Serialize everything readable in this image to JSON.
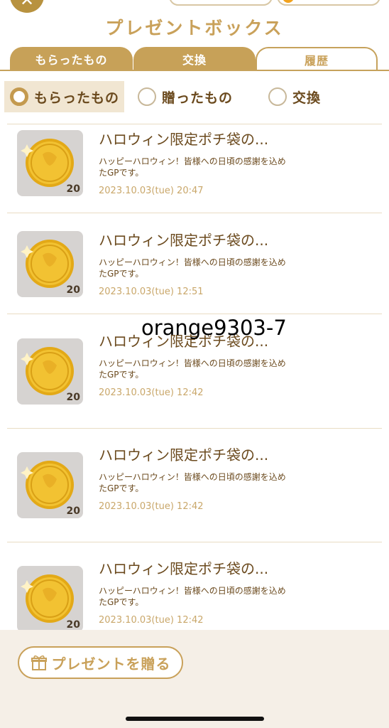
{
  "header": {
    "close_label": "✕",
    "title": "プレゼントボックス"
  },
  "tabs": [
    {
      "label": "もらったもの"
    },
    {
      "label": "交換"
    },
    {
      "label": "履歴"
    }
  ],
  "filters": [
    {
      "label": "もらったもの",
      "selected": true
    },
    {
      "label": "贈ったもの",
      "selected": false
    },
    {
      "label": "交換",
      "selected": false
    }
  ],
  "items": [
    {
      "name": "ハロウィン限定ポチ袋の...",
      "desc": "ハッピーハロウィン！皆様への日頃の感謝を込めたGPです。",
      "date": "2023.10.03(tue) 20:47",
      "qty": "20"
    },
    {
      "name": "ハロウィン限定ポチ袋の...",
      "desc": "ハッピーハロウィン！皆様への日頃の感謝を込めたGPです。",
      "date": "2023.10.03(tue) 12:51",
      "qty": "20"
    },
    {
      "name": "ハロウィン限定ポチ袋の...",
      "desc": "ハッピーハロウィン！皆様への日頃の感謝を込めたGPです。",
      "date": "2023.10.03(tue) 12:42",
      "qty": "20"
    },
    {
      "name": "ハロウィン限定ポチ袋の...",
      "desc": "ハッピーハロウィン！皆様への日頃の感謝を込めたGPです。",
      "date": "2023.10.03(tue) 12:42",
      "qty": "20"
    },
    {
      "name": "ハロウィン限定ポチ袋の...",
      "desc": "ハッピーハロウィン！皆様への日頃の感謝を込めたGPです。",
      "date": "2023.10.03(tue) 12:42",
      "qty": "20"
    }
  ],
  "watermark": "orange9303-7",
  "footer": {
    "send_label": "プレゼントを贈る"
  },
  "colors": {
    "accent": "#c9a15a",
    "text": "#6b4a1e",
    "date": "#c9a76a",
    "footer_bg": "#f5efe7"
  }
}
